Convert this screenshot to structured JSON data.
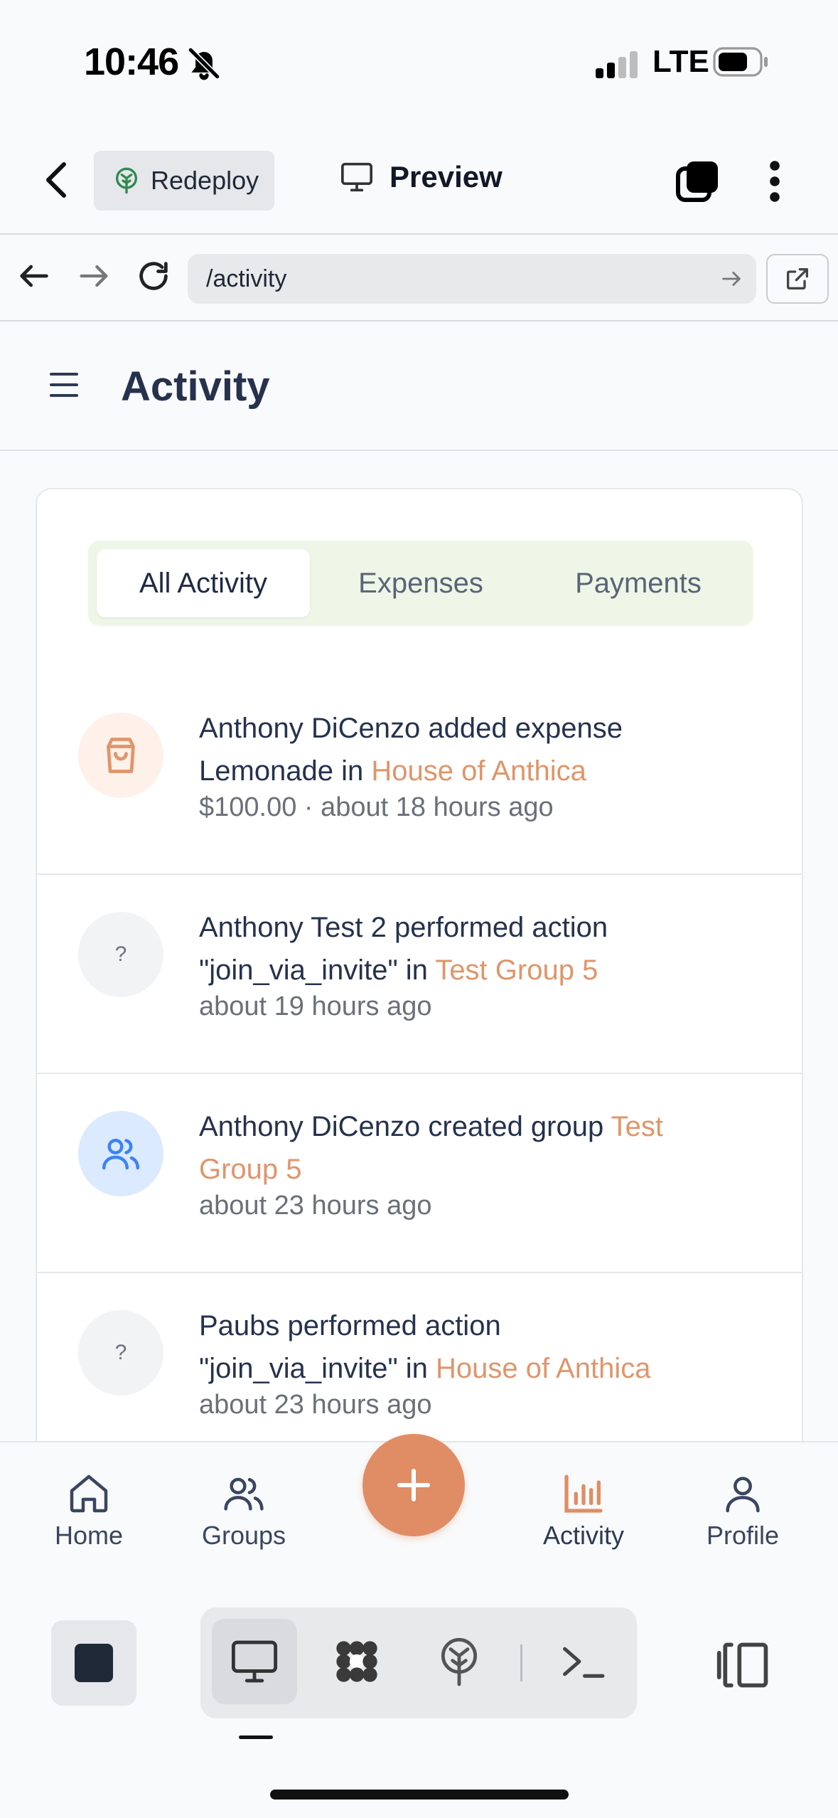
{
  "status_bar": {
    "time": "10:46",
    "network": "LTE"
  },
  "toolbar": {
    "redeploy_label": "Redeploy",
    "preview_label": "Preview"
  },
  "browser": {
    "url": "/activity"
  },
  "page": {
    "title": "Activity"
  },
  "tabs": [
    {
      "label": "All Activity",
      "active": true
    },
    {
      "label": "Expenses",
      "active": false
    },
    {
      "label": "Payments",
      "active": false
    }
  ],
  "feed": [
    {
      "icon": "shopping-bag-icon",
      "line1": "Anthony DiCenzo added expense",
      "line2_pre": "Lemonade in ",
      "group": "House of Anthica",
      "meta": "$100.00 · about 18 hours ago"
    },
    {
      "icon": "question-mark-icon",
      "icon_text": "?",
      "line1": "Anthony Test 2 performed action",
      "line2_pre": "\"join_via_invite\" in ",
      "group": "Test Group 5",
      "meta": "about 19 hours ago"
    },
    {
      "icon": "users-icon",
      "line1": "Anthony DiCenzo created group ",
      "group_part1": "Test",
      "group_part2": "Group 5",
      "meta": "about 23 hours ago"
    },
    {
      "icon": "question-mark-icon",
      "icon_text": "?",
      "line1": "Paubs performed action",
      "line2_pre": "\"join_via_invite\" in ",
      "group": "House of Anthica",
      "meta": "about 23 hours ago"
    }
  ],
  "bottom_nav": {
    "items": [
      {
        "label": "Home",
        "icon": "home-icon"
      },
      {
        "label": "Groups",
        "icon": "groups-icon"
      },
      {
        "label": "Activity",
        "icon": "bar-chart-icon",
        "active": true
      },
      {
        "label": "Profile",
        "icon": "user-icon"
      }
    ],
    "fab_icon": "plus-icon"
  },
  "colors": {
    "accent": "#e08d65",
    "group_link": "#e0956a",
    "tabs_bg": "#eef6e8",
    "text_primary": "#26324d"
  }
}
